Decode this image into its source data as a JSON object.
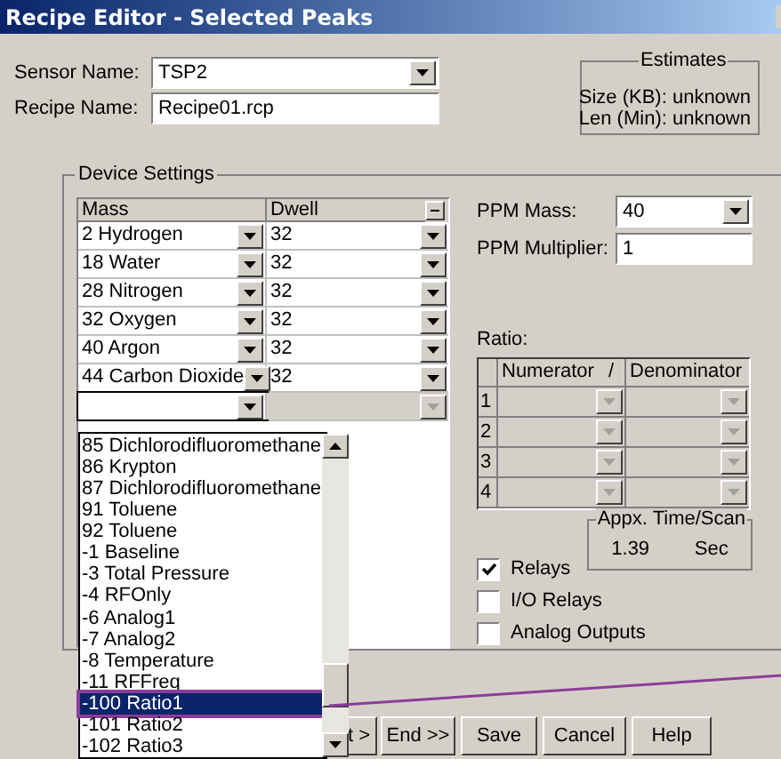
{
  "window": {
    "title": "Recipe Editor - Selected Peaks"
  },
  "sensor": {
    "label": "Sensor Name:",
    "value": "TSP2"
  },
  "recipe": {
    "label": "Recipe Name:",
    "value": "Recipe01.rcp"
  },
  "estimates": {
    "title": "Estimates",
    "rows": [
      {
        "label": "Size (KB):",
        "value": "unknown"
      },
      {
        "label": "Len (Min):",
        "value": "unknown"
      }
    ]
  },
  "device_settings": {
    "title": "Device Settings",
    "columns": [
      "Mass",
      "Dwell"
    ],
    "rows": [
      {
        "mass": "2 Hydrogen",
        "dwell": "32",
        "disabled": false
      },
      {
        "mass": "18 Water",
        "dwell": "32",
        "disabled": false
      },
      {
        "mass": "28 Nitrogen",
        "dwell": "32",
        "disabled": false
      },
      {
        "mass": "32 Oxygen",
        "dwell": "32",
        "disabled": false
      },
      {
        "mass": "40 Argon",
        "dwell": "32",
        "disabled": false
      },
      {
        "mass": "44 Carbon Dioxide",
        "dwell": "32",
        "disabled": false
      },
      {
        "disabled": true
      }
    ]
  },
  "ppm_mass": {
    "label": "PPM Mass:",
    "value": "40"
  },
  "ppm_multiplier": {
    "label": "PPM Multiplier:",
    "value": "1"
  },
  "ratio": {
    "label": "Ratio:",
    "columns": [
      "Numerator",
      "/",
      "Denominator"
    ],
    "rows": [
      "1",
      "2",
      "3",
      "4"
    ]
  },
  "time_scan": {
    "title": "Appx. Time/Scan",
    "value": "1.39",
    "unit": "Sec"
  },
  "options": [
    {
      "label": "Relays",
      "checked": true
    },
    {
      "label": "I/O Relays",
      "checked": false
    },
    {
      "label": "Analog Outputs",
      "checked": false
    }
  ],
  "mass_dropdown": {
    "items": [
      {
        "label": "85 Dichlorodifluoromethane",
        "selected": false
      },
      {
        "label": "86 Krypton",
        "selected": false
      },
      {
        "label": "87 Dichlorodifluoromethane",
        "selected": false
      },
      {
        "label": "91 Toluene",
        "selected": false
      },
      {
        "label": "92 Toluene",
        "selected": false
      },
      {
        "label": "-1 Baseline",
        "selected": false
      },
      {
        "label": "-3 Total Pressure",
        "selected": false
      },
      {
        "label": "-4 RFOnly",
        "selected": false
      },
      {
        "label": "-6 Analog1",
        "selected": false
      },
      {
        "label": "-7 Analog2",
        "selected": false
      },
      {
        "label": "-8 Temperature",
        "selected": false
      },
      {
        "label": "-11 RFFreq",
        "selected": false
      },
      {
        "label": "-100 Ratio1",
        "selected": true
      },
      {
        "label": "-101 Ratio2",
        "selected": false
      },
      {
        "label": "-102 Ratio3",
        "selected": false
      }
    ]
  },
  "buttons": [
    "t >",
    "End >>",
    "Save",
    "Cancel",
    "Help"
  ]
}
